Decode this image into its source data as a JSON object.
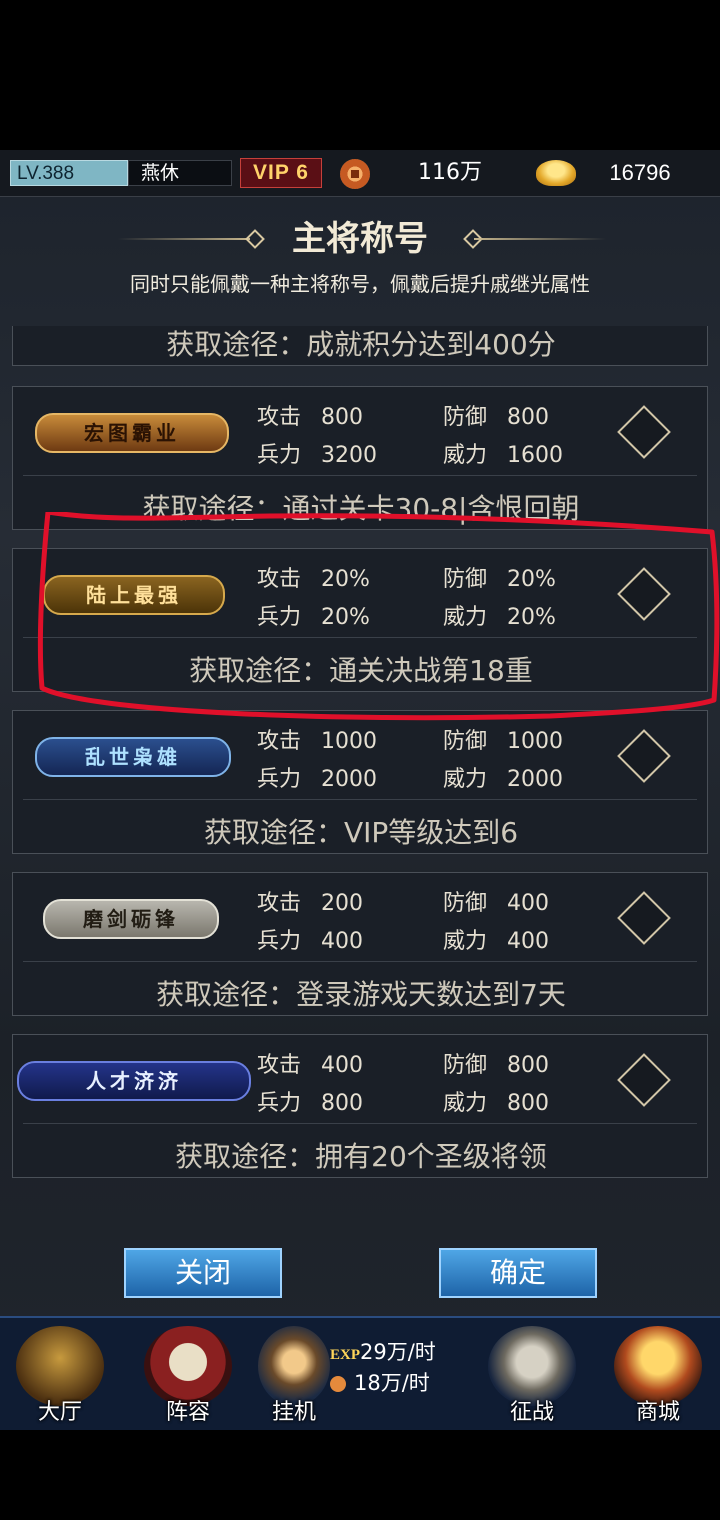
{
  "topbar": {
    "level": "LV.388",
    "player_name": "燕休",
    "vip": "VIP 6",
    "coin_value": "116万",
    "gold_value": "16796"
  },
  "header": {
    "title": "主将称号",
    "subtitle": "同时只能佩戴一种主将称号，佩戴后提升戚继光属性"
  },
  "titles": [
    {
      "badge": "",
      "requirement": "获取途径：成就积分达到400分"
    },
    {
      "badge": "宏图霸业",
      "attack": "800",
      "defense": "800",
      "troops": "3200",
      "power": "1600",
      "requirement": "获取途径：通过关卡30-8|含恨回朝"
    },
    {
      "badge": "陆上最强",
      "attack": "20%",
      "defense": "20%",
      "troops": "20%",
      "power": "20%",
      "requirement": "获取途径：通关决战第18重"
    },
    {
      "badge": "乱世枭雄",
      "attack": "1000",
      "defense": "1000",
      "troops": "2000",
      "power": "2000",
      "requirement": "获取途径：VIP等级达到6"
    },
    {
      "badge": "磨剑砺锋",
      "attack": "200",
      "defense": "400",
      "troops": "400",
      "power": "400",
      "requirement": "获取途径：登录游戏天数达到7天"
    },
    {
      "badge": "人才济济",
      "attack": "400",
      "defense": "800",
      "troops": "800",
      "power": "800",
      "requirement": "获取途径：拥有20个圣级将领"
    }
  ],
  "labels": {
    "attack": "攻击",
    "defense": "防御",
    "troops": "兵力",
    "power": "威力"
  },
  "buttons": {
    "close": "关闭",
    "confirm": "确定"
  },
  "nav": {
    "hall": "大厅",
    "lineup": "阵容",
    "idle": "挂机",
    "exp_tag": "EXP",
    "exp_rate": "29万/时",
    "coin_rate": "18万/时",
    "campaign": "征战",
    "shop": "商城"
  },
  "colors": {
    "annotation_red": "#e0102a",
    "button_blue": "#2f86cf",
    "nav_bg": "#0f1c33"
  }
}
